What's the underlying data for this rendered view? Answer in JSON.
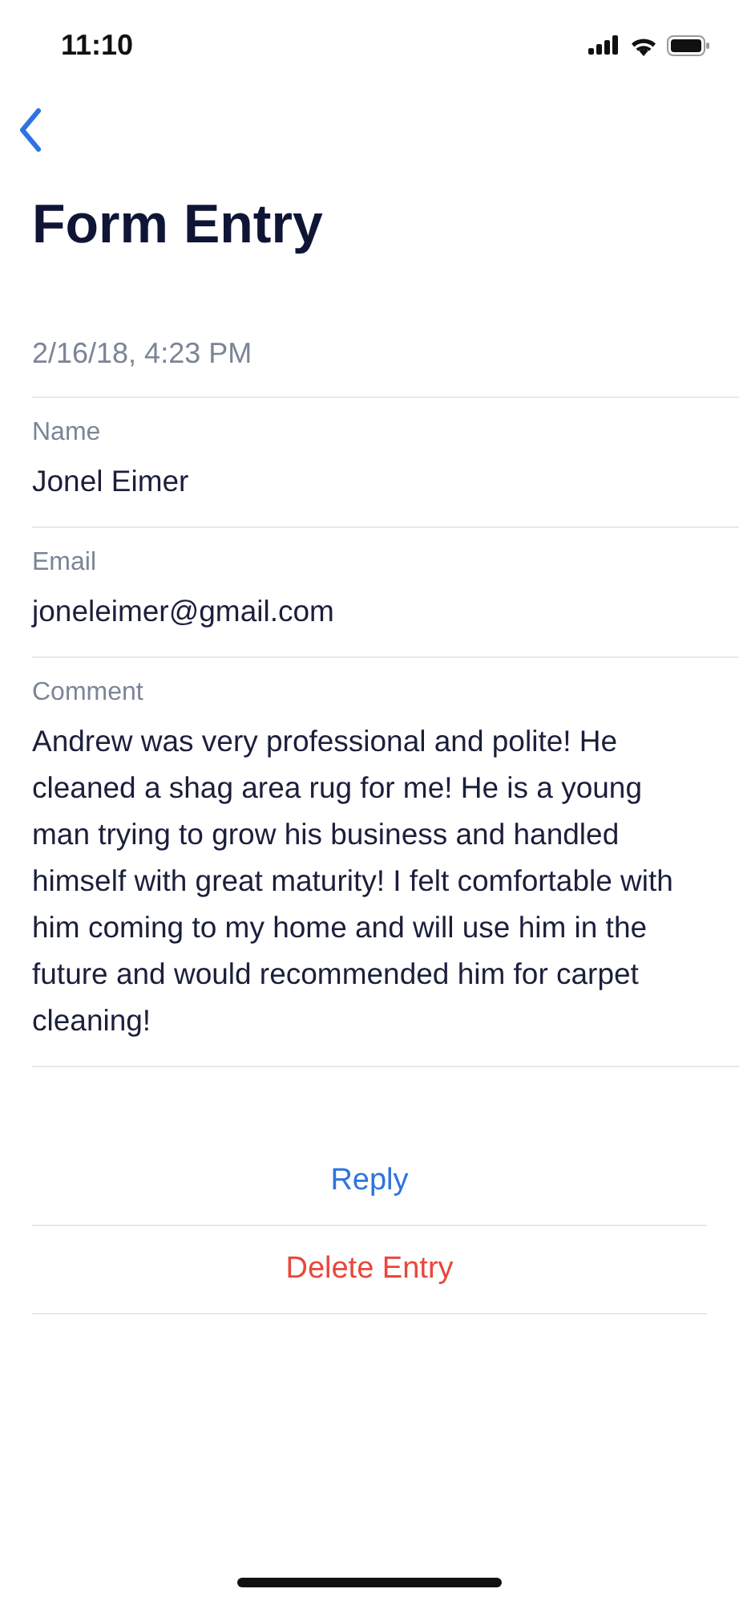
{
  "status_bar": {
    "time": "11:10"
  },
  "title": "Form Entry",
  "date": "2/16/18, 4:23 PM",
  "fields": [
    {
      "label": "Name",
      "value": "Jonel Eimer"
    },
    {
      "label": "Email",
      "value": "joneleimer@gmail.com"
    },
    {
      "label": "Comment",
      "value": "Andrew was very professional and polite! He cleaned a shag area rug for me! He is a young man trying to grow his business and handled himself with great maturity! I felt comfortable with him coming to my home and will use him in the future and would recommended him for carpet cleaning!"
    }
  ],
  "actions": [
    {
      "label": "Reply",
      "kind": "primary"
    },
    {
      "label": "Delete Entry",
      "kind": "destructive"
    }
  ]
}
